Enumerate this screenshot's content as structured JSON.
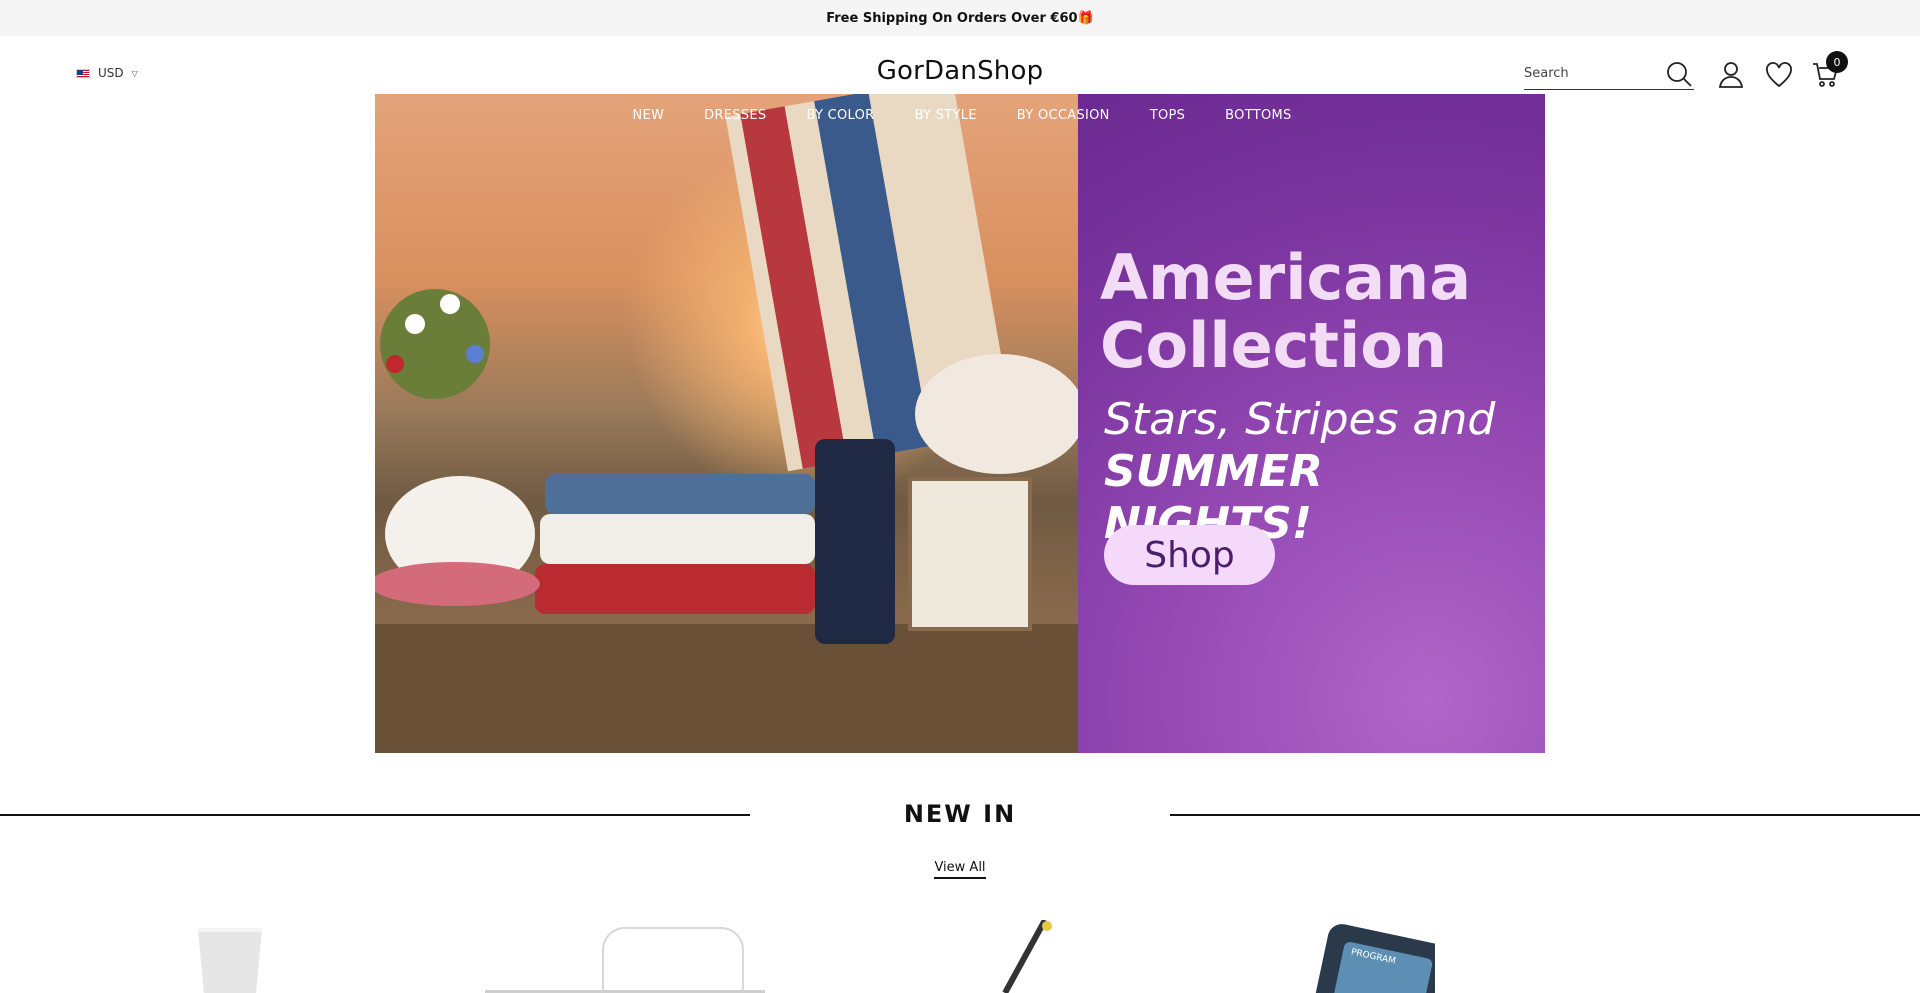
{
  "announcement": "Free Shipping On Orders Over €60🎁",
  "header": {
    "currency": "USD",
    "logo": "GorDanShop",
    "search_placeholder": "Search",
    "cart_count": "0"
  },
  "nav": [
    "NEW",
    "DRESSES",
    "BY COLOR",
    "BY STYLE",
    "BY OCCASION",
    "TOPS",
    "BOTTOMS"
  ],
  "hero": {
    "title_line1": "Americana",
    "title_line2": "Collection",
    "sub_line1": "Stars, Stripes and",
    "sub_line2": "SUMMER NIGHTS!",
    "button": "Shop"
  },
  "section": {
    "title": "NEW IN",
    "view_all": "View All"
  },
  "colors": {
    "announcement_bg": "#f5f5f5",
    "hero_purple": "#7c35a0",
    "hero_title": "#f3dcf6",
    "button_bg": "#f4d9fa"
  }
}
